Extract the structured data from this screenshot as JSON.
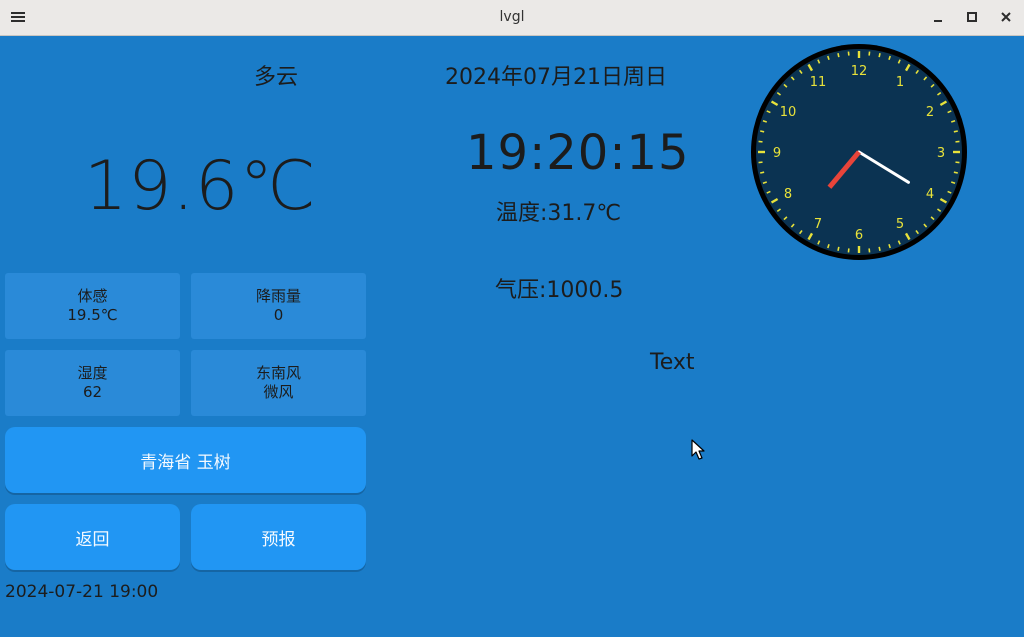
{
  "window": {
    "title": "lvgl",
    "menu_icon": "hamburger-icon",
    "minimize_glyph": "‒",
    "maximize_glyph": "▪",
    "close_glyph": "✕"
  },
  "weather": {
    "condition": "多云",
    "temperature": "19.6℃"
  },
  "datetime": {
    "date": "2024年07月21日周日",
    "time": "19:20:15"
  },
  "indoor": {
    "temperature": "温度:31.7℃",
    "pressure": "气压:1000.5",
    "placeholder_text": "Text"
  },
  "cards": {
    "feels_like": {
      "label": "体感",
      "value": "19.5℃"
    },
    "rainfall": {
      "label": "降雨量",
      "value": "0"
    },
    "humidity": {
      "label": "湿度",
      "value": "62"
    },
    "wind": {
      "label": "东南风",
      "value": "微风"
    }
  },
  "buttons": {
    "location": "青海省  玉树",
    "back": "返回",
    "forecast": "预报"
  },
  "updated_at": "2024-07-21  19:00",
  "clock": {
    "hour": 19,
    "minute": 20,
    "second": 15,
    "numbers": [
      "12",
      "1",
      "2",
      "3",
      "4",
      "5",
      "6",
      "7",
      "8",
      "9",
      "10",
      "11"
    ],
    "face_color": "#0b3352",
    "rim_color": "#000000",
    "tick_color": "#e8e23a",
    "hour_hand_color": "#e8443a",
    "minute_hand_color": "#ffffff"
  },
  "colors": {
    "background": "#1a7cc8",
    "card": "#2a8ad8",
    "button": "#2196f3"
  }
}
